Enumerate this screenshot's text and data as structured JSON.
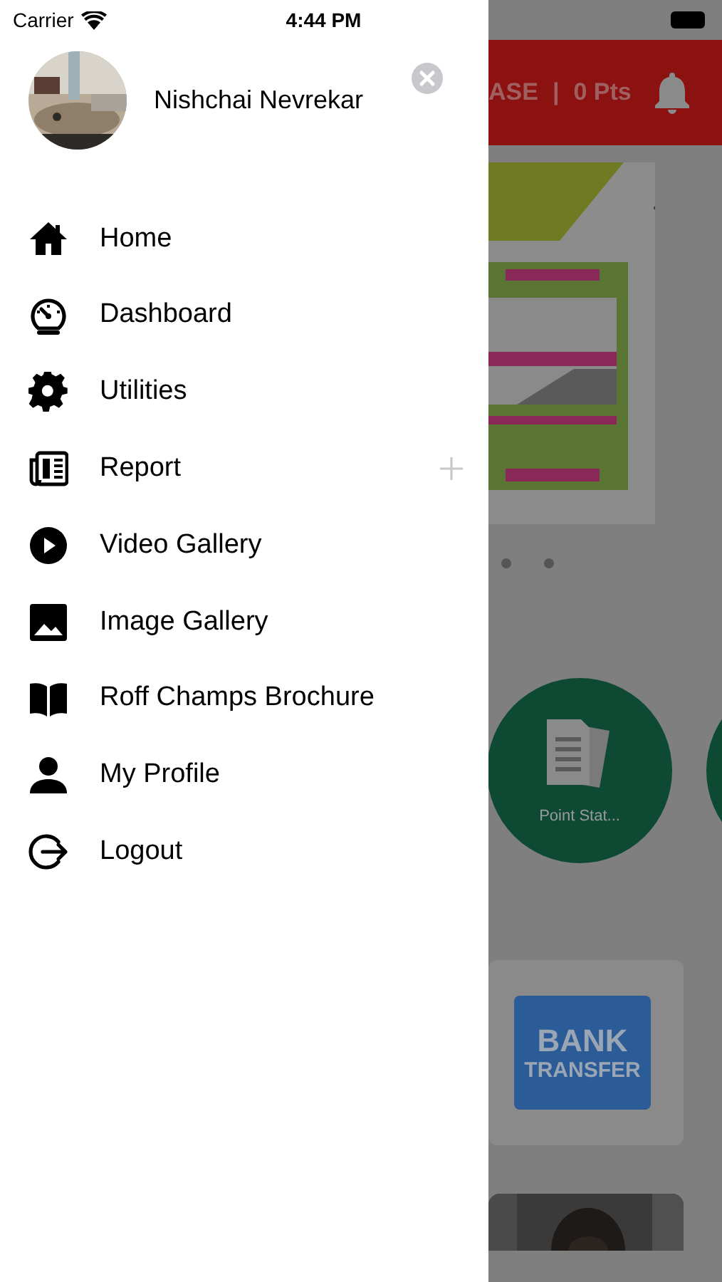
{
  "status_bar": {
    "carrier": "Carrier",
    "time": "4:44 PM"
  },
  "profile": {
    "name": "Nishchai Nevrekar"
  },
  "menu": [
    {
      "label": "Home",
      "expandable": false
    },
    {
      "label": "Dashboard",
      "expandable": false
    },
    {
      "label": "Utilities",
      "expandable": false
    },
    {
      "label": "Report",
      "expandable": true
    },
    {
      "label": "Video Gallery",
      "expandable": false
    },
    {
      "label": "Image Gallery",
      "expandable": false
    },
    {
      "label": "Roff Champs Brochure",
      "expandable": false
    },
    {
      "label": "My Profile",
      "expandable": false
    },
    {
      "label": "Logout",
      "expandable": false
    }
  ],
  "background_screen": {
    "header": {
      "title": "ASE",
      "separator": "|",
      "points": "0 Pts"
    },
    "carousel_dots": [
      {
        "selected": false
      },
      {
        "selected": false
      }
    ],
    "shortcuts": [
      {
        "label": "Point Stat..."
      }
    ],
    "bank_card": {
      "line_1": "BANK",
      "line_2": "TRANSFER"
    }
  }
}
